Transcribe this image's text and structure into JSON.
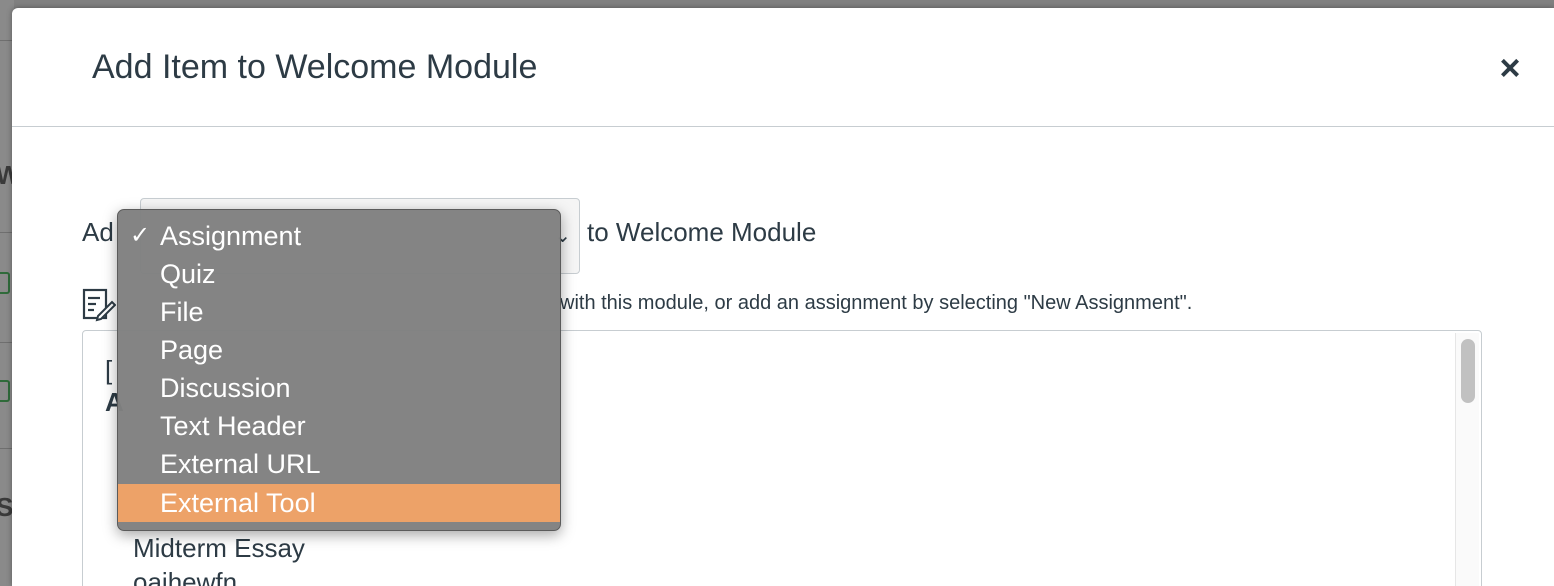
{
  "modal": {
    "title": "Add Item to Welcome Module",
    "close_label": "×"
  },
  "add_row": {
    "prefix": "Ad",
    "suffix": "to Welcome Module",
    "chevron": "⌄"
  },
  "hint": {
    "icon": "assignment-edit-icon",
    "text": "with this module, or add an assignment by selecting \"New Assignment\"."
  },
  "list": {
    "bracket_text": "[",
    "bold_text": "A",
    "items": [
      "Midterm Essay",
      "oaihewfn"
    ]
  },
  "dropdown": {
    "check_mark": "✓",
    "options": [
      {
        "label": "Assignment",
        "checked": true,
        "highlighted": false
      },
      {
        "label": "Quiz",
        "checked": false,
        "highlighted": false
      },
      {
        "label": "File",
        "checked": false,
        "highlighted": false
      },
      {
        "label": "Page",
        "checked": false,
        "highlighted": false
      },
      {
        "label": "Discussion",
        "checked": false,
        "highlighted": false
      },
      {
        "label": "Text Header",
        "checked": false,
        "highlighted": false
      },
      {
        "label": "External URL",
        "checked": false,
        "highlighted": false
      },
      {
        "label": "External Tool",
        "checked": false,
        "highlighted": true
      }
    ],
    "highlight_color": "#eda268"
  },
  "background": {
    "letters": [
      "W",
      "S"
    ]
  }
}
